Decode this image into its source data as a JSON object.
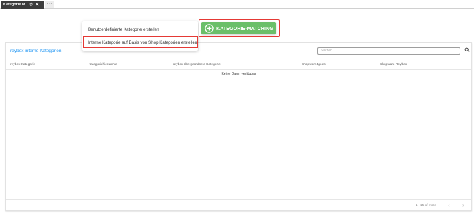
{
  "tabs": {
    "active": {
      "label": "Kategorie M...",
      "pin_icon": "star-icon",
      "close_icon": "close-icon"
    },
    "more_label": "···"
  },
  "actions": {
    "main_button_label": "KATEGORIE-MATCHING",
    "main_button_icon": "add-circle-icon",
    "menu_items": [
      {
        "label": "Benutzerdefinierte Kategorie erstellen"
      },
      {
        "label": "Interne Kategorie auf Basis von Shop Kategorien erstellen"
      }
    ]
  },
  "card": {
    "title": "reybex interne Kategorien",
    "search_placeholder": "Suchen",
    "columns": [
      "reybex Kategorie",
      "Kategoriehierarchie",
      "reybex übergeordnete Kategorie",
      "Shopware4goes",
      "Shopware Reybex"
    ],
    "empty_text": "Keine Daten verfügbar",
    "pagination": "1 - 15 of more",
    "prev_label": "‹",
    "next_label": "›"
  },
  "colors": {
    "accent": "#2196f3",
    "cta_green": "#6abf69",
    "highlight_red": "#e53935",
    "tab_dark": "#3c3c3c"
  }
}
